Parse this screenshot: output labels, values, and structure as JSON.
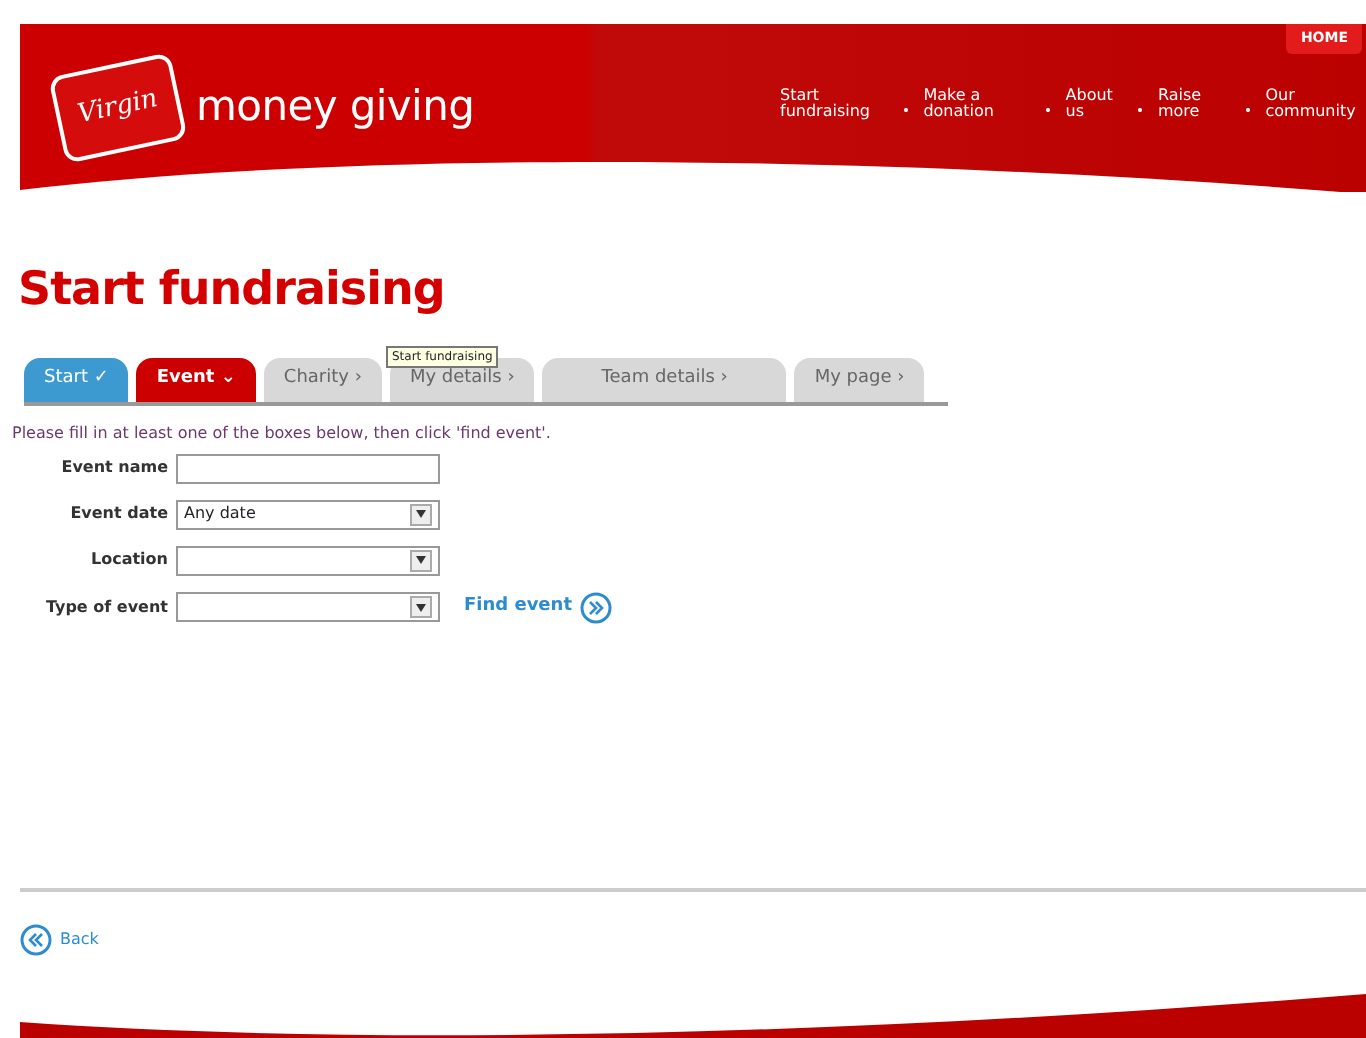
{
  "header": {
    "logo_badge": "Virgin",
    "logo_text": "money giving",
    "home_button": "HOME",
    "nav": [
      "Start fundraising",
      "Make a donation",
      "About us",
      "Raise more",
      "Our community"
    ]
  },
  "page_title": "Start fundraising",
  "tooltip": "Start fundraising",
  "steps": [
    {
      "label": "Start ✓",
      "kind": "done",
      "selected": false
    },
    {
      "label": "Event ⌄",
      "kind": "current",
      "selected": true
    },
    {
      "label": "Charity ›",
      "kind": "pending",
      "selected": false
    },
    {
      "label": "My details ›",
      "kind": "pending",
      "selected": false
    },
    {
      "label": "Team details ›",
      "kind": "pending",
      "selected": false
    },
    {
      "label": "My page ›",
      "kind": "pending",
      "selected": false
    }
  ],
  "instructions": "Please fill in at least one of the boxes below, then click 'find event'.",
  "fields": [
    {
      "label": "Event name",
      "kind": "text"
    },
    {
      "label": "Event date",
      "kind": "select",
      "value": "Any date"
    },
    {
      "label": "Location",
      "kind": "select"
    },
    {
      "label": "Type of event",
      "kind": "select"
    }
  ],
  "find_button": "Find event",
  "back_link": "Back"
}
